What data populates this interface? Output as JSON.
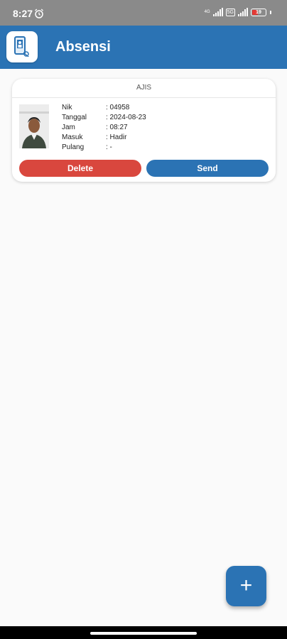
{
  "status_bar": {
    "time": "8:27",
    "alarm_icon": "alarm-clock-icon",
    "network_label": "4G",
    "network_badge": "5G",
    "battery_level": "19",
    "battery_color": "#e53935"
  },
  "app_bar": {
    "title": "Absensi",
    "logo_icon": "phone-attendance-icon",
    "color": "#2b73b4"
  },
  "record": {
    "header": "AJIS",
    "fields": [
      {
        "label": "Nik",
        "value": ": 04958"
      },
      {
        "label": "Tanggal",
        "value": ": 2024-08-23"
      },
      {
        "label": "Jam",
        "value": ": 08:27"
      },
      {
        "label": "Masuk",
        "value": ": Hadir"
      },
      {
        "label": "Pulang",
        "value": ": -"
      }
    ],
    "delete_label": "Delete",
    "send_label": "Send",
    "delete_color": "#d9473e",
    "send_color": "#2b73b4"
  },
  "fab": {
    "label": "+",
    "icon": "plus-icon"
  }
}
